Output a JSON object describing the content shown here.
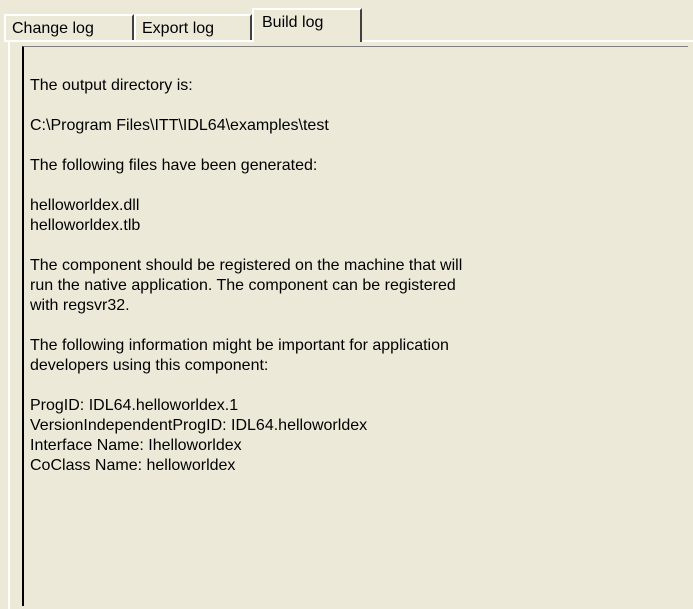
{
  "tabs": [
    {
      "label": "Change log",
      "active": false
    },
    {
      "label": "Export log",
      "active": false
    },
    {
      "label": "Build log",
      "active": true
    }
  ],
  "build_log": {
    "lines": [
      "The output directory is:",
      "",
      "C:\\Program Files\\ITT\\IDL64\\examples\\test",
      "",
      "The following files have been generated:",
      "",
      "helloworldex.dll",
      "helloworldex.tlb",
      "",
      "The component should be registered on the machine that will",
      "run the native application. The component can be registered",
      "with regsvr32.",
      "",
      "The following information might be important for application",
      "developers using this component:",
      "",
      "ProgID: IDL64.helloworldex.1",
      "VersionIndependentProgID: IDL64.helloworldex",
      "Interface Name: Ihelloworldex",
      "CoClass Name: helloworldex"
    ]
  },
  "colors": {
    "dialog_background": "#ece9d8",
    "highlight": "#ffffff",
    "shadow": "#404040"
  }
}
